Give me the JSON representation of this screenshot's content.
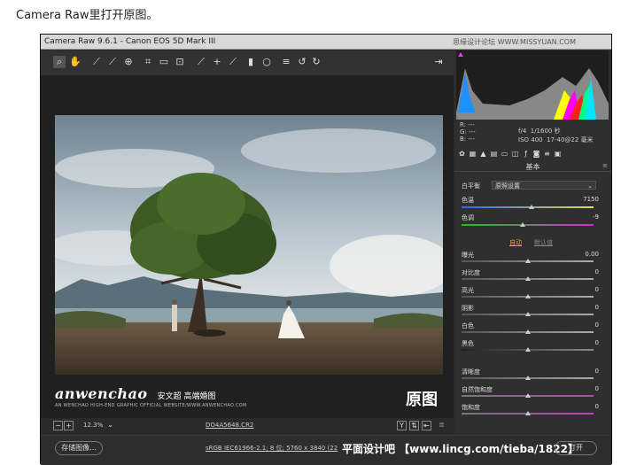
{
  "caption": "Camera Raw里打开原图。",
  "window": {
    "title": "Camera Raw 9.6.1 - Canon EOS 5D Mark III",
    "title_watermark": "思缘设计论坛 WWW.MISSYUAN.COM"
  },
  "toolbar": {
    "tools": [
      "zoom-tool",
      "hand-tool",
      "white-balance-tool",
      "color-sampler-tool",
      "targeted-adjustment-tool",
      "crop-tool",
      "straighten-tool",
      "transform-tool",
      "spot-removal-tool",
      "red-eye-tool",
      "adjustment-brush-tool",
      "graduated-filter-tool",
      "radial-filter-tool",
      "presets-menu",
      "rotate-ccw",
      "rotate-cw"
    ],
    "open_preferences": "preferences-icon"
  },
  "preview": {
    "brand_logo": "anwenchao",
    "brand_cn": "安文超 高端婚图",
    "brand_sub": "AN WENCHAO HIGH-END GRAPHIC OFFICIAL WEBSITE/WWW.ANWENCHAO.COM",
    "overlay_label": "原图"
  },
  "statusbar": {
    "zoom": "12.3%",
    "filename": "DO4A5648.CR2",
    "view_y": "Y"
  },
  "bottombar": {
    "save_label": "存储图像...",
    "color_info": "sRGB IEC61966-2.1; 8 位; 5760 x 3840 (22",
    "watermark": "平面设计吧 【www.lincg.com/tieba/1822】",
    "right_button": "打开"
  },
  "histogram": {
    "r_label": "R:",
    "g_label": "G:",
    "b_label": "B:",
    "r_val": "---",
    "g_val": "---",
    "b_val": "---",
    "aperture": "f/4",
    "shutter": "1/1600 秒",
    "iso": "ISO 400",
    "lens": "17-40@22 毫米"
  },
  "panel": {
    "section_title": "基本",
    "white_balance_label": "白平衡",
    "white_balance_value": "原照设置",
    "temp_label": "色温",
    "temp_value": "7150",
    "tint_label": "色调",
    "tint_value": "-9",
    "auto_label": "自动",
    "default_label": "默认值",
    "sliders": [
      {
        "label": "曝光",
        "value": "0.00",
        "pos": 0.5
      },
      {
        "label": "对比度",
        "value": "0",
        "pos": 0.5
      },
      {
        "label": "高光",
        "value": "0",
        "pos": 0.5
      },
      {
        "label": "阴影",
        "value": "0",
        "pos": 0.5
      },
      {
        "label": "白色",
        "value": "0",
        "pos": 0.5
      },
      {
        "label": "黑色",
        "value": "0",
        "pos": 0.5
      },
      {
        "label": "清晰度",
        "value": "0",
        "pos": 0.5
      },
      {
        "label": "自然饱和度",
        "value": "0",
        "pos": 0.5
      },
      {
        "label": "饱和度",
        "value": "0",
        "pos": 0.5
      }
    ],
    "temp_pos": 0.53,
    "tint_pos": 0.46
  },
  "colors": {
    "accent": "#e040fb",
    "link": "#f0a040",
    "link_muted": "#888888"
  }
}
